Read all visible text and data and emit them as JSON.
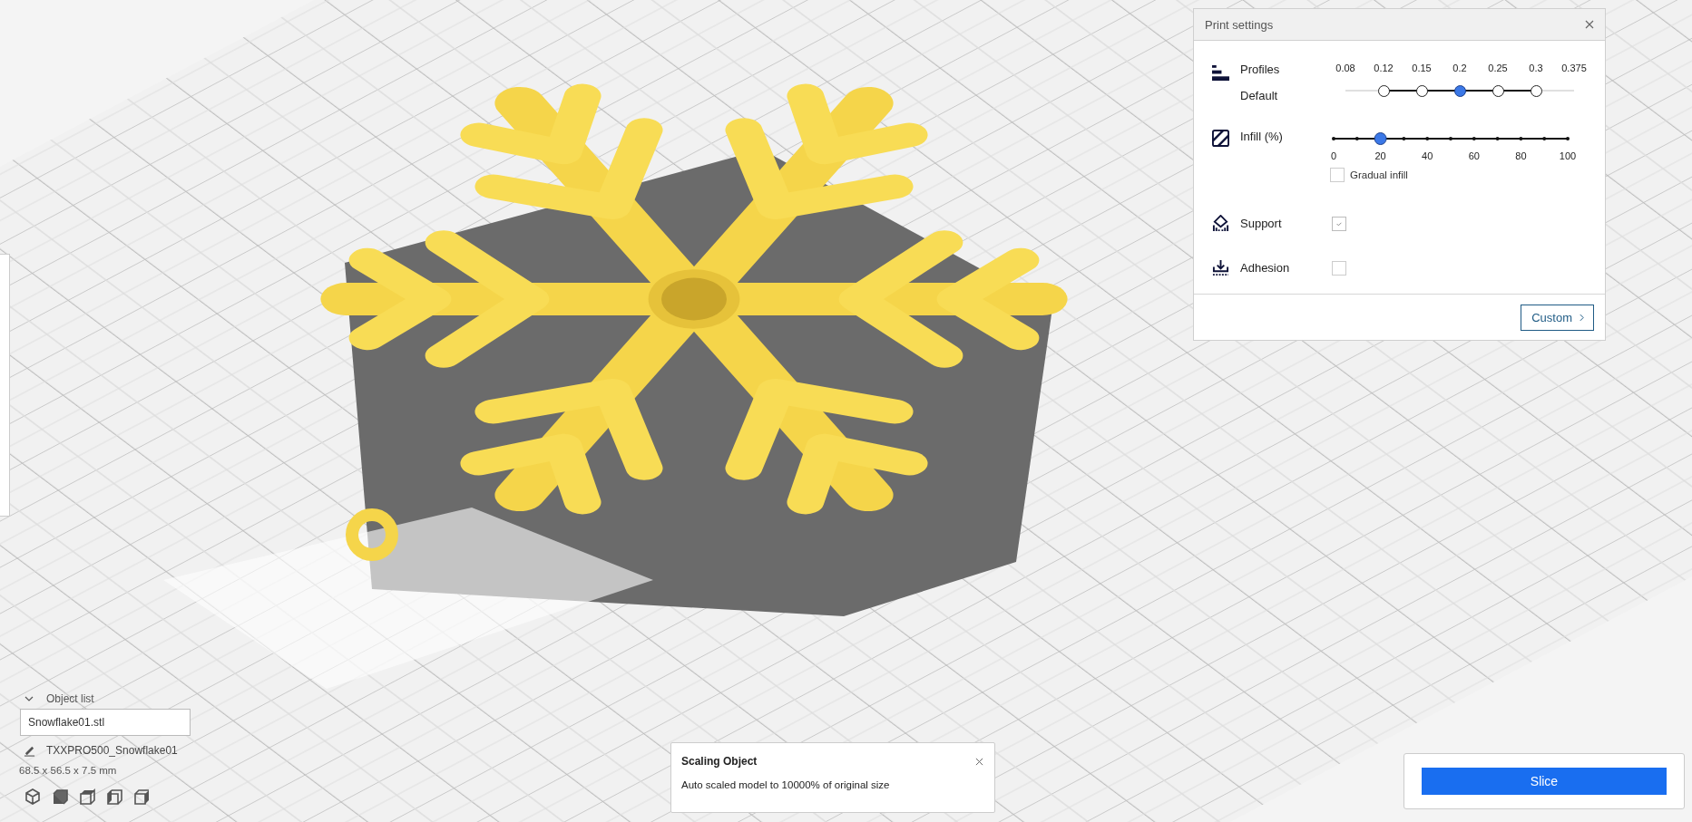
{
  "print_settings": {
    "title": "Print settings",
    "profiles": {
      "label": "Profiles",
      "profile_name": "Default",
      "layer_heights": [
        {
          "label": "0.08",
          "available": false,
          "selected": false
        },
        {
          "label": "0.12",
          "available": true,
          "selected": false
        },
        {
          "label": "0.15",
          "available": true,
          "selected": false
        },
        {
          "label": "0.2",
          "available": true,
          "selected": true
        },
        {
          "label": "0.25",
          "available": true,
          "selected": false
        },
        {
          "label": "0.3",
          "available": true,
          "selected": false
        },
        {
          "label": "0.375",
          "available": false,
          "selected": false
        }
      ]
    },
    "infill": {
      "label": "Infill (%)",
      "level": 0.2,
      "ticks": [
        "0",
        "20",
        "40",
        "60",
        "80",
        "100"
      ],
      "gradual": {
        "label": "Gradual infill",
        "checked": false
      }
    },
    "support": {
      "label": "Support",
      "checked": true
    },
    "adhesion": {
      "label": "Adhesion",
      "checked": false
    },
    "custom_button": "Custom"
  },
  "object_list": {
    "title": "Object list",
    "expanded": true,
    "objects": [
      {
        "name": "Snowflake01.stl"
      }
    ],
    "printer": "TXXPRO500_Snowflake01",
    "dimensions": "68.5 x 56.5 x 7.5 mm"
  },
  "notification": {
    "title": "Scaling Object",
    "message": "Auto scaled model to 10000% of original size"
  },
  "slice_button": "Slice"
}
